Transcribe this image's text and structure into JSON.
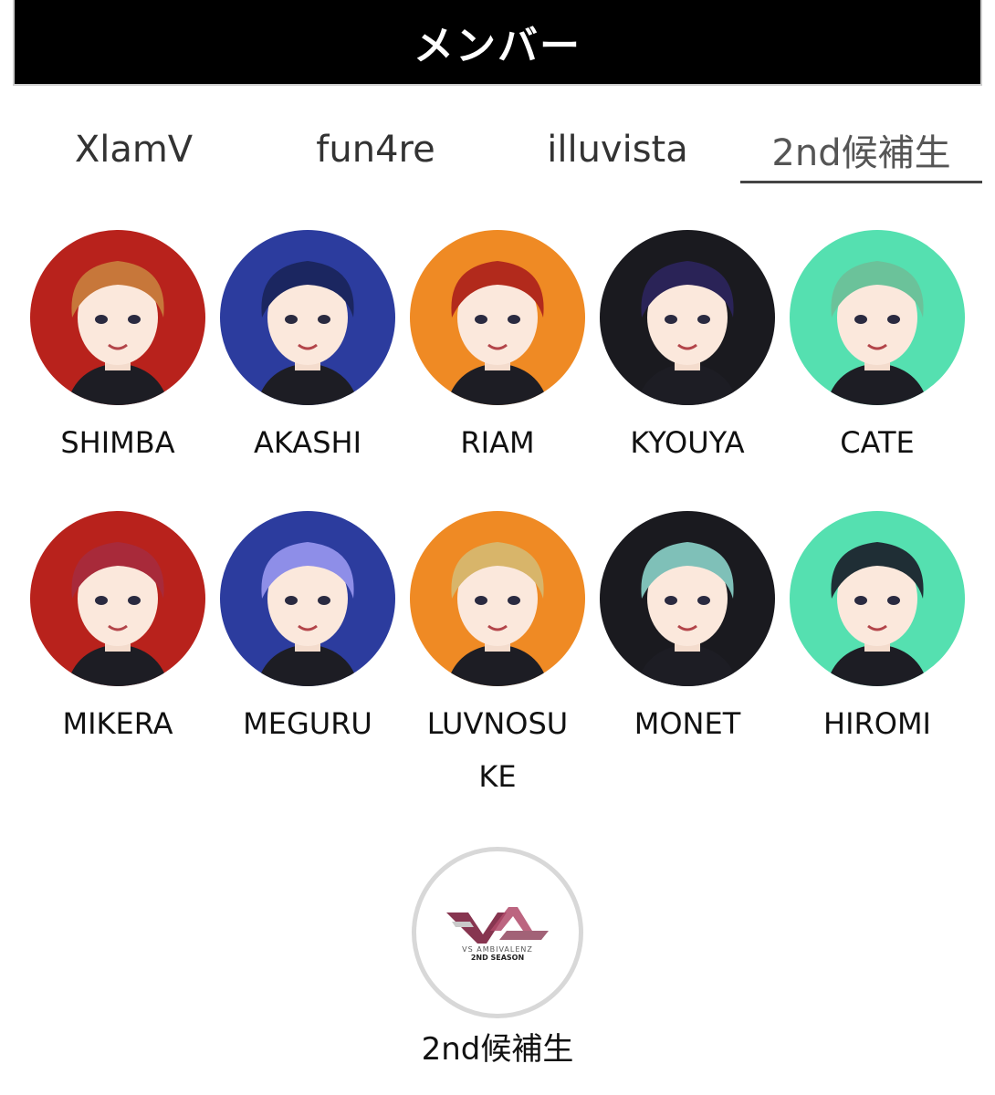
{
  "header": {
    "title": "メンバー"
  },
  "tabs": [
    {
      "label": "XlamV",
      "active": false
    },
    {
      "label": "fun4re",
      "active": false
    },
    {
      "label": "illuvista",
      "active": false
    },
    {
      "label": "2nd候補生",
      "active": true
    }
  ],
  "members": [
    {
      "name": "SHIMBA",
      "bg": "#b8221c",
      "hair": "#c7773a"
    },
    {
      "name": "AKASHI",
      "bg": "#2c3c9e",
      "hair": "#1b2660"
    },
    {
      "name": "RIAM",
      "bg": "#ef8a24",
      "hair": "#b22a1c"
    },
    {
      "name": "KYOUYA",
      "bg": "#1a1a1f",
      "hair": "#2a2357"
    },
    {
      "name": "CATE",
      "bg": "#55e0b0",
      "hair": "#6bc29a"
    },
    {
      "name": "MIKERA",
      "bg": "#b8221c",
      "hair": "#a82a3a"
    },
    {
      "name": "MEGURU",
      "bg": "#2c3c9e",
      "hair": "#8e8ee8"
    },
    {
      "name": "LUVNOSUKE",
      "bg": "#ef8a24",
      "hair": "#d8b56a"
    },
    {
      "name": "MONET",
      "bg": "#1a1a1f",
      "hair": "#7fc0b8"
    },
    {
      "name": "HIROMI",
      "bg": "#55e0b0",
      "hair": "#1f2e35"
    }
  ],
  "group_logo": {
    "line1": "VS AMBIVALENZ",
    "line2": "2ND SEASON",
    "label": "2nd候補生"
  },
  "colors": {
    "header_bg": "#000000",
    "logo_accent": "#7a1f3d"
  }
}
